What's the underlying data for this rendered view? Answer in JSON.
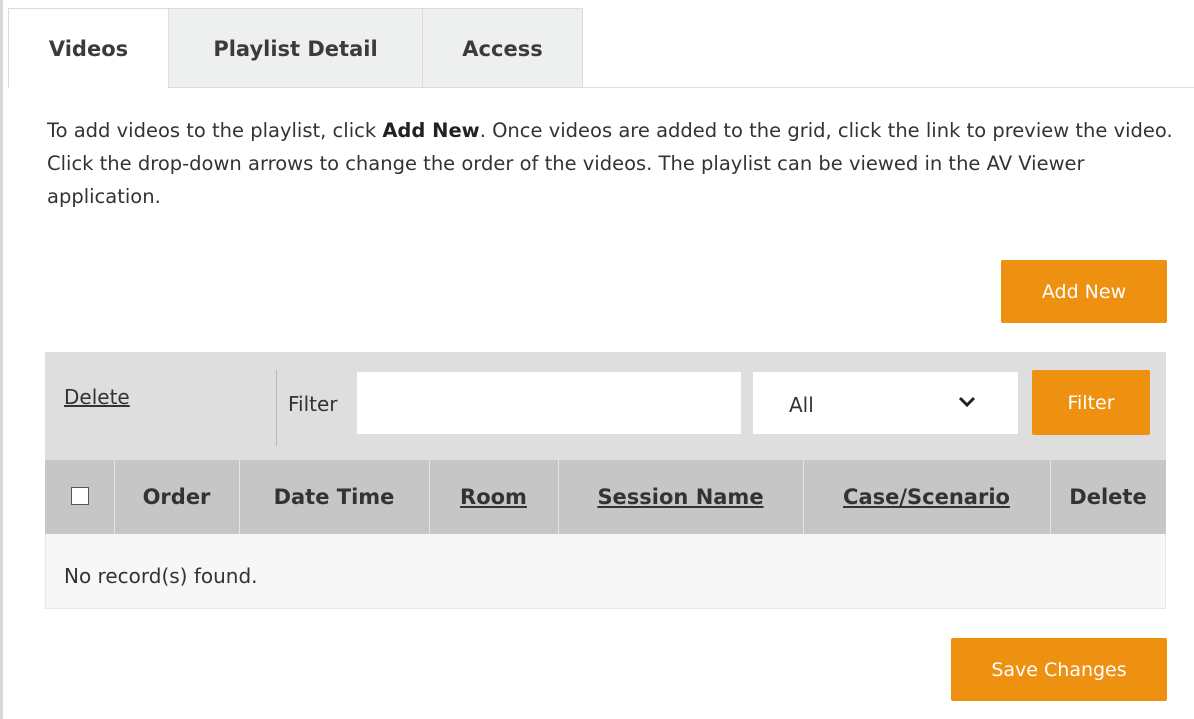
{
  "tabs": [
    {
      "label": "Videos",
      "active": true
    },
    {
      "label": "Playlist Detail",
      "active": false
    },
    {
      "label": "Access",
      "active": false
    }
  ],
  "description": {
    "before": "To add videos to the playlist, click ",
    "bold": "Add New",
    "after": ". Once videos are added to the grid, click the link to preview the video. Click the drop-down arrows to change the order of the videos. The playlist can be viewed in the AV Viewer application."
  },
  "buttons": {
    "add_new": "Add New",
    "filter": "Filter",
    "save_changes": "Save Changes"
  },
  "toolbar": {
    "delete_link": "Delete",
    "filter_label": "Filter",
    "filter_input_value": "",
    "select_value": "All"
  },
  "grid": {
    "columns": [
      "Order",
      "Date Time",
      "Room",
      "Session Name",
      "Case/Scenario",
      "Delete"
    ],
    "empty_message": "No record(s) found."
  },
  "colors": {
    "accent": "#ee9010",
    "toolbar_bg": "#dedede",
    "header_bg": "#c6c6c6"
  },
  "icons": {
    "dropdown": "chevron-down-icon",
    "select_all": "checkbox"
  }
}
